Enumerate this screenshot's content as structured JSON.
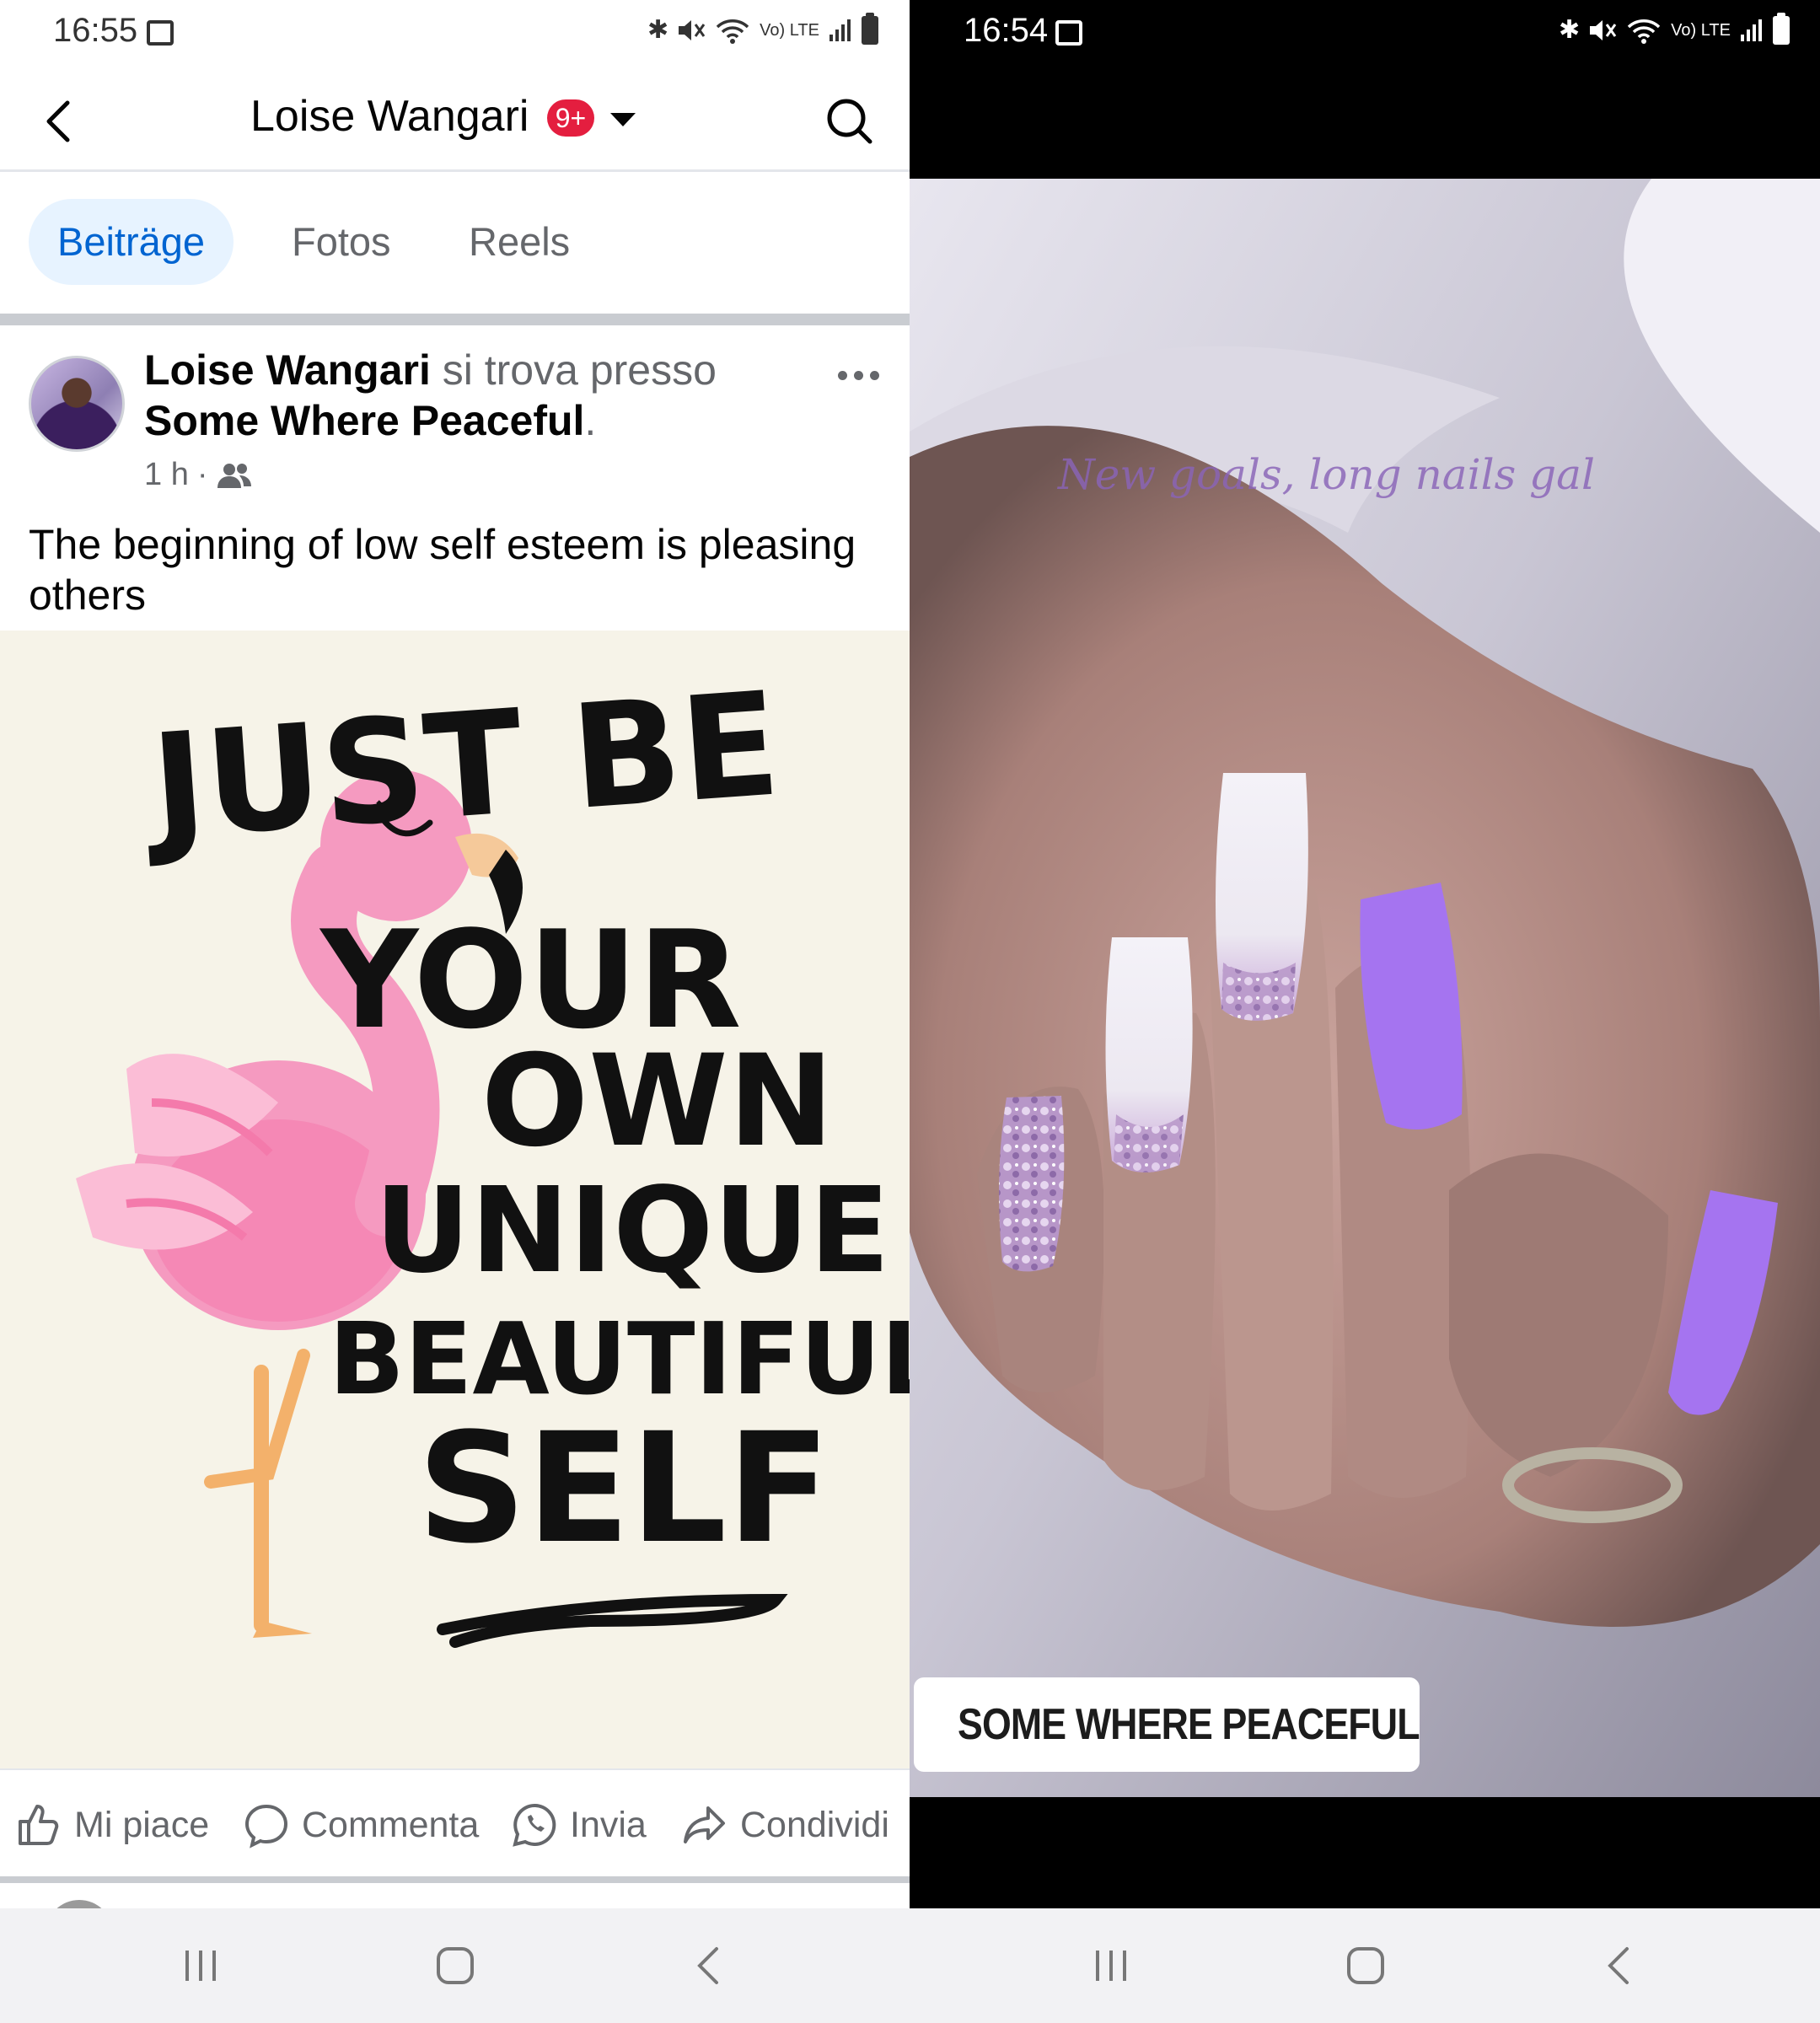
{
  "left": {
    "status": {
      "time": "16:55",
      "network": "Vo) LTE"
    },
    "header": {
      "title": "Loise Wangari",
      "badge": "9+"
    },
    "tabs": [
      {
        "label": "Beiträge",
        "active": true
      },
      {
        "label": "Fotos",
        "active": false
      },
      {
        "label": "Reels",
        "active": false
      }
    ],
    "post": {
      "author": "Loise Wangari",
      "checkin_text": " si trova presso",
      "place": "Some Where Peaceful",
      "place_suffix": ".",
      "time": "1 h",
      "audience_icon": "friends-icon",
      "text": "The beginning of low self esteem is pleasing others",
      "image_lines": [
        "JUST BE",
        "YOUR",
        "OWN",
        "UNIQUE",
        "BEAUTIFUL",
        "SELF"
      ]
    },
    "actions": {
      "like": "Mi piace",
      "comment": "Commenta",
      "send": "Invia",
      "share": "Condividi"
    }
  },
  "right": {
    "status": {
      "time": "16:54",
      "network": "Vo) LTE"
    },
    "story": {
      "caption": "New goals, long nails gal",
      "location": "SOME WHERE PEACEFUL"
    }
  },
  "nav": {
    "icons": [
      "recent-apps-icon",
      "home-icon",
      "back-icon"
    ]
  },
  "colors": {
    "accent_blue": "#0064d1",
    "tab_active_bg": "#e7f3ff",
    "badge_red": "#e41e3f",
    "flamingo_pink": "#f59ac0",
    "nail_lilac": "#a574f0",
    "pin_blue": "#1a8cff"
  }
}
